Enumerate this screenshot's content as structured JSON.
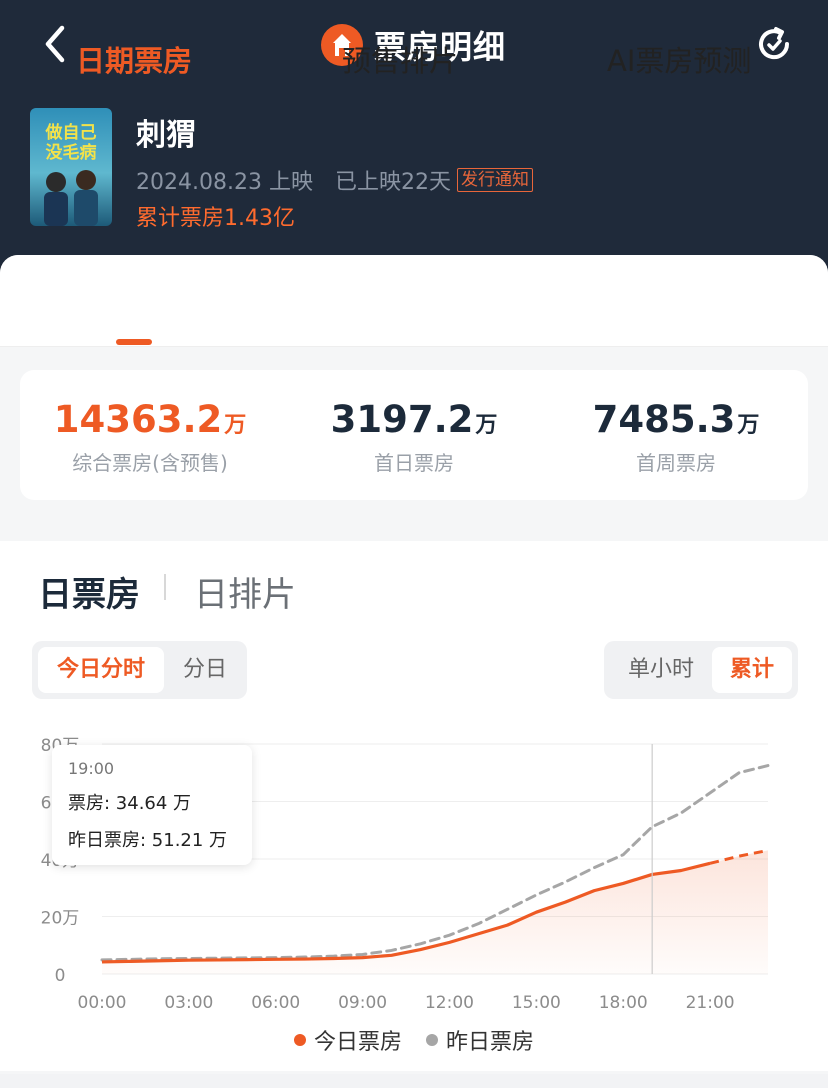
{
  "header": {
    "title": "票房明细",
    "colors": {
      "background": "#1f2a3a",
      "accent": "#ee5a24"
    },
    "icons": {
      "back": "chevron-left-icon",
      "logo": "ticket-house-logo",
      "refresh": "refresh-icon"
    }
  },
  "movie": {
    "name": "刺猬",
    "poster_text_line1": "做自己",
    "poster_text_line2": "没毛病",
    "release": "2024.08.23 上映",
    "days": "已上映22天",
    "notice": "发行通知",
    "total": "累计票房1.43亿"
  },
  "tabs": [
    {
      "label": "日期票房",
      "active": true
    },
    {
      "label": "预售排片",
      "active": false
    },
    {
      "label": "AI票房预测",
      "active": false
    }
  ],
  "stats": [
    {
      "value": "14363.2",
      "unit": "万",
      "label": "综合票房(含预售)"
    },
    {
      "value": "3197.2",
      "unit": "万",
      "label": "首日票房"
    },
    {
      "value": "7485.3",
      "unit": "万",
      "label": "首周票房"
    }
  ],
  "section_tabs": {
    "active": "日票房",
    "other": "日排片"
  },
  "segments_left": {
    "on": "今日分时",
    "off": "分日"
  },
  "segments_right": {
    "off": "单小时",
    "on": "累计"
  },
  "tooltip": {
    "time": "19:00",
    "row1": "票房: 34.64 万",
    "row2": "昨日票房: 51.21 万"
  },
  "chart_data": {
    "type": "line",
    "ylabels": [
      "80万",
      "60万",
      "40万",
      "20万",
      "0"
    ],
    "xlabels": [
      "00:00",
      "03:00",
      "06:00",
      "09:00",
      "12:00",
      "15:00",
      "18:00",
      "21:00"
    ],
    "ylim": [
      0,
      80
    ],
    "x_hours": [
      0,
      1,
      2,
      3,
      4,
      5,
      6,
      7,
      8,
      9,
      10,
      11,
      12,
      13,
      14,
      15,
      16,
      17,
      18,
      19,
      20,
      21,
      22,
      23
    ],
    "series": [
      {
        "name": "今日票房",
        "color": "#ee5a24",
        "dashed_after_hour": 21,
        "values": [
          4.2,
          4.4,
          4.6,
          4.8,
          4.9,
          5.0,
          5.1,
          5.2,
          5.4,
          5.7,
          6.5,
          8.5,
          11.0,
          14.0,
          17.0,
          21.5,
          25.0,
          29.0,
          31.5,
          34.64,
          36.0,
          38.5,
          41.0,
          43.0
        ]
      },
      {
        "name": "昨日票房",
        "color": "#a6a6a6",
        "dashed": true,
        "values": [
          4.9,
          5.1,
          5.3,
          5.4,
          5.5,
          5.6,
          5.7,
          5.9,
          6.2,
          6.8,
          8.2,
          10.5,
          13.5,
          17.5,
          22.5,
          27.5,
          32.0,
          37.0,
          41.5,
          51.21,
          56.0,
          63.0,
          70.0,
          72.5
        ]
      }
    ],
    "tooltip_hour": 19,
    "grid": true
  },
  "legend": [
    {
      "label": "今日票房",
      "color": "#ee5a24"
    },
    {
      "label": "昨日票房",
      "color": "#a6a6a6"
    }
  ]
}
